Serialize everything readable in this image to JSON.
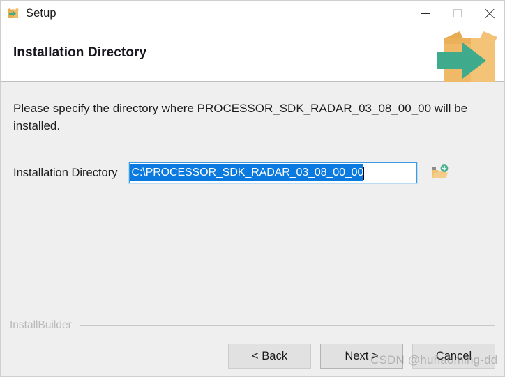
{
  "window": {
    "title": "Setup",
    "title_icon": "installer-box-icon",
    "controls": {
      "minimize": "minimize-icon",
      "maximize": "maximize-icon",
      "close": "close-icon"
    }
  },
  "header": {
    "title": "Installation Directory",
    "logo": "installer-box-arrow-logo"
  },
  "main": {
    "intro": "Please specify the directory where PROCESSOR_SDK_RADAR_03_08_00_00 will be installed.",
    "field": {
      "label": "Installation Directory",
      "value": "C:\\PROCESSOR_SDK_RADAR_03_08_00_00",
      "placeholder": "",
      "selected": true,
      "browse_icon": "folder-browse-icon"
    }
  },
  "footer": {
    "brand": "InstallBuilder",
    "buttons": [
      {
        "label": "< Back",
        "default": false
      },
      {
        "label": "Next >",
        "default": true
      },
      {
        "label": "Cancel",
        "default": false
      }
    ]
  },
  "watermark": "CSDN @huhaoming-dd",
  "colors": {
    "accent_selection": "#0a7ae0",
    "focus_border": "#3d9ae0",
    "body_bg": "#efefef",
    "logo_box": "#efb861",
    "logo_arrow": "#3bab8a",
    "brand_text": "#b9b9b9"
  }
}
